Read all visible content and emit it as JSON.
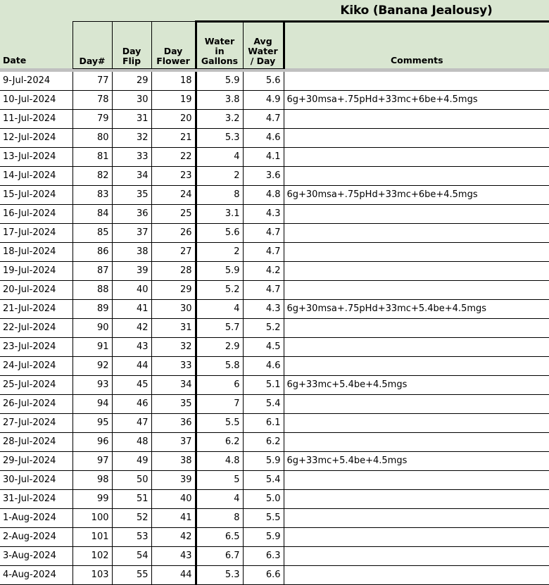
{
  "title": "Kiko (Banana Jealousy)",
  "columns": {
    "date": "Date",
    "day_num": "Day#",
    "day_flip_l1": "Day",
    "day_flip_l2": "Flip",
    "day_flower_l1": "Day",
    "day_flower_l2": "Flower",
    "water_l1": "Water",
    "water_l2": "in",
    "water_l3": "Gallons",
    "avg_l1": "Avg",
    "avg_l2": "Water",
    "avg_l3": "/ Day",
    "comments": "Comments"
  },
  "colors": {
    "header_green": "#d9e6d1",
    "avg_column_fill": "#f0f0f0",
    "band_gray": "#c0c0c0",
    "grid_line": "#000000"
  },
  "rows": [
    {
      "date": "9-Jul-2024",
      "day": "77",
      "flip": "29",
      "flower": "18",
      "water": "5.9",
      "avg": "5.6",
      "comment": ""
    },
    {
      "date": "10-Jul-2024",
      "day": "78",
      "flip": "30",
      "flower": "19",
      "water": "3.8",
      "avg": "4.9",
      "comment": "6g+30msa+.75pHd+33mc+6be+4.5mgs"
    },
    {
      "date": "11-Jul-2024",
      "day": "79",
      "flip": "31",
      "flower": "20",
      "water": "3.2",
      "avg": "4.7",
      "comment": ""
    },
    {
      "date": "12-Jul-2024",
      "day": "80",
      "flip": "32",
      "flower": "21",
      "water": "5.3",
      "avg": "4.6",
      "comment": ""
    },
    {
      "date": "13-Jul-2024",
      "day": "81",
      "flip": "33",
      "flower": "22",
      "water": "4",
      "avg": "4.1",
      "comment": ""
    },
    {
      "date": "14-Jul-2024",
      "day": "82",
      "flip": "34",
      "flower": "23",
      "water": "2",
      "avg": "3.6",
      "comment": ""
    },
    {
      "date": "15-Jul-2024",
      "day": "83",
      "flip": "35",
      "flower": "24",
      "water": "8",
      "avg": "4.8",
      "comment": "6g+30msa+.75pHd+33mc+6be+4.5mgs"
    },
    {
      "date": "16-Jul-2024",
      "day": "84",
      "flip": "36",
      "flower": "25",
      "water": "3.1",
      "avg": "4.3",
      "comment": ""
    },
    {
      "date": "17-Jul-2024",
      "day": "85",
      "flip": "37",
      "flower": "26",
      "water": "5.6",
      "avg": "4.7",
      "comment": ""
    },
    {
      "date": "18-Jul-2024",
      "day": "86",
      "flip": "38",
      "flower": "27",
      "water": "2",
      "avg": "4.7",
      "comment": ""
    },
    {
      "date": "19-Jul-2024",
      "day": "87",
      "flip": "39",
      "flower": "28",
      "water": "5.9",
      "avg": "4.2",
      "comment": ""
    },
    {
      "date": "20-Jul-2024",
      "day": "88",
      "flip": "40",
      "flower": "29",
      "water": "5.2",
      "avg": "4.7",
      "comment": ""
    },
    {
      "date": "21-Jul-2024",
      "day": "89",
      "flip": "41",
      "flower": "30",
      "water": "4",
      "avg": "4.3",
      "comment": "6g+30msa+.75pHd+33mc+5.4be+4.5mgs"
    },
    {
      "date": "22-Jul-2024",
      "day": "90",
      "flip": "42",
      "flower": "31",
      "water": "5.7",
      "avg": "5.2",
      "comment": ""
    },
    {
      "date": "23-Jul-2024",
      "day": "91",
      "flip": "43",
      "flower": "32",
      "water": "2.9",
      "avg": "4.5",
      "comment": ""
    },
    {
      "date": "24-Jul-2024",
      "day": "92",
      "flip": "44",
      "flower": "33",
      "water": "5.8",
      "avg": "4.6",
      "comment": ""
    },
    {
      "date": "25-Jul-2024",
      "day": "93",
      "flip": "45",
      "flower": "34",
      "water": "6",
      "avg": "5.1",
      "comment": "6g+33mc+5.4be+4.5mgs"
    },
    {
      "date": "26-Jul-2024",
      "day": "94",
      "flip": "46",
      "flower": "35",
      "water": "7",
      "avg": "5.4",
      "comment": ""
    },
    {
      "date": "27-Jul-2024",
      "day": "95",
      "flip": "47",
      "flower": "36",
      "water": "5.5",
      "avg": "6.1",
      "comment": ""
    },
    {
      "date": "28-Jul-2024",
      "day": "96",
      "flip": "48",
      "flower": "37",
      "water": "6.2",
      "avg": "6.2",
      "comment": ""
    },
    {
      "date": "29-Jul-2024",
      "day": "97",
      "flip": "49",
      "flower": "38",
      "water": "4.8",
      "avg": "5.9",
      "comment": "6g+33mc+5.4be+4.5mgs"
    },
    {
      "date": "30-Jul-2024",
      "day": "98",
      "flip": "50",
      "flower": "39",
      "water": "5",
      "avg": "5.4",
      "comment": ""
    },
    {
      "date": "31-Jul-2024",
      "day": "99",
      "flip": "51",
      "flower": "40",
      "water": "4",
      "avg": "5.0",
      "comment": ""
    },
    {
      "date": "1-Aug-2024",
      "day": "100",
      "flip": "52",
      "flower": "41",
      "water": "8",
      "avg": "5.5",
      "comment": ""
    },
    {
      "date": "2-Aug-2024",
      "day": "101",
      "flip": "53",
      "flower": "42",
      "water": "6.5",
      "avg": "5.9",
      "comment": ""
    },
    {
      "date": "3-Aug-2024",
      "day": "102",
      "flip": "54",
      "flower": "43",
      "water": "6.7",
      "avg": "6.3",
      "comment": ""
    },
    {
      "date": "4-Aug-2024",
      "day": "103",
      "flip": "55",
      "flower": "44",
      "water": "5.3",
      "avg": "6.6",
      "comment": ""
    }
  ],
  "chart_data": {
    "type": "table",
    "title": "Kiko (Banana Jealousy)",
    "columns": [
      "Date",
      "Day#",
      "Day Flip",
      "Day Flower",
      "Water in Gallons",
      "Avg Water / Day",
      "Comments"
    ],
    "x": [
      "9-Jul-2024",
      "10-Jul-2024",
      "11-Jul-2024",
      "12-Jul-2024",
      "13-Jul-2024",
      "14-Jul-2024",
      "15-Jul-2024",
      "16-Jul-2024",
      "17-Jul-2024",
      "18-Jul-2024",
      "19-Jul-2024",
      "20-Jul-2024",
      "21-Jul-2024",
      "22-Jul-2024",
      "23-Jul-2024",
      "24-Jul-2024",
      "25-Jul-2024",
      "26-Jul-2024",
      "27-Jul-2024",
      "28-Jul-2024",
      "29-Jul-2024",
      "30-Jul-2024",
      "31-Jul-2024",
      "1-Aug-2024",
      "2-Aug-2024",
      "3-Aug-2024",
      "4-Aug-2024"
    ],
    "series": [
      {
        "name": "Day#",
        "values": [
          77,
          78,
          79,
          80,
          81,
          82,
          83,
          84,
          85,
          86,
          87,
          88,
          89,
          90,
          91,
          92,
          93,
          94,
          95,
          96,
          97,
          98,
          99,
          100,
          101,
          102,
          103
        ]
      },
      {
        "name": "Day Flip",
        "values": [
          29,
          30,
          31,
          32,
          33,
          34,
          35,
          36,
          37,
          38,
          39,
          40,
          41,
          42,
          43,
          44,
          45,
          46,
          47,
          48,
          49,
          50,
          51,
          52,
          53,
          54,
          55
        ]
      },
      {
        "name": "Day Flower",
        "values": [
          18,
          19,
          20,
          21,
          22,
          23,
          24,
          25,
          26,
          27,
          28,
          29,
          30,
          31,
          32,
          33,
          34,
          35,
          36,
          37,
          38,
          39,
          40,
          41,
          42,
          43,
          44
        ]
      },
      {
        "name": "Water in Gallons",
        "values": [
          5.9,
          3.8,
          3.2,
          5.3,
          4,
          2,
          8,
          3.1,
          5.6,
          2,
          5.9,
          5.2,
          4,
          5.7,
          2.9,
          5.8,
          6,
          7,
          5.5,
          6.2,
          4.8,
          5,
          4,
          8,
          6.5,
          6.7,
          5.3
        ]
      },
      {
        "name": "Avg Water / Day",
        "values": [
          5.6,
          4.9,
          4.7,
          4.6,
          4.1,
          3.6,
          4.8,
          4.3,
          4.7,
          4.7,
          4.2,
          4.7,
          4.3,
          5.2,
          4.5,
          4.6,
          5.1,
          5.4,
          6.1,
          6.2,
          5.9,
          5.4,
          5.0,
          5.5,
          5.9,
          6.3,
          6.6
        ]
      }
    ],
    "annotations": [
      {
        "x": "10-Jul-2024",
        "text": "6g+30msa+.75pHd+33mc+6be+4.5mgs"
      },
      {
        "x": "15-Jul-2024",
        "text": "6g+30msa+.75pHd+33mc+6be+4.5mgs"
      },
      {
        "x": "21-Jul-2024",
        "text": "6g+30msa+.75pHd+33mc+5.4be+4.5mgs"
      },
      {
        "x": "25-Jul-2024",
        "text": "6g+33mc+5.4be+4.5mgs"
      },
      {
        "x": "29-Jul-2024",
        "text": "6g+33mc+5.4be+4.5mgs"
      }
    ]
  }
}
